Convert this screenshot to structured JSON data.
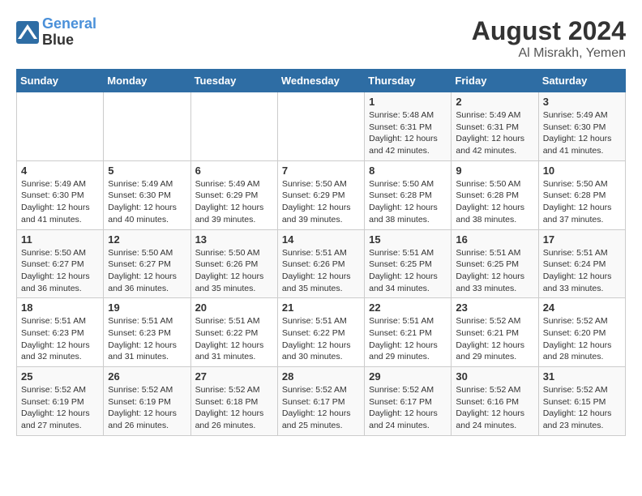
{
  "header": {
    "logo_line1": "General",
    "logo_line2": "Blue",
    "title": "August 2024",
    "subtitle": "Al Misrakh, Yemen"
  },
  "calendar": {
    "days_of_week": [
      "Sunday",
      "Monday",
      "Tuesday",
      "Wednesday",
      "Thursday",
      "Friday",
      "Saturday"
    ],
    "weeks": [
      [
        {
          "day": "",
          "info": ""
        },
        {
          "day": "",
          "info": ""
        },
        {
          "day": "",
          "info": ""
        },
        {
          "day": "",
          "info": ""
        },
        {
          "day": "1",
          "info": "Sunrise: 5:48 AM\nSunset: 6:31 PM\nDaylight: 12 hours\nand 42 minutes."
        },
        {
          "day": "2",
          "info": "Sunrise: 5:49 AM\nSunset: 6:31 PM\nDaylight: 12 hours\nand 42 minutes."
        },
        {
          "day": "3",
          "info": "Sunrise: 5:49 AM\nSunset: 6:30 PM\nDaylight: 12 hours\nand 41 minutes."
        }
      ],
      [
        {
          "day": "4",
          "info": "Sunrise: 5:49 AM\nSunset: 6:30 PM\nDaylight: 12 hours\nand 41 minutes."
        },
        {
          "day": "5",
          "info": "Sunrise: 5:49 AM\nSunset: 6:30 PM\nDaylight: 12 hours\nand 40 minutes."
        },
        {
          "day": "6",
          "info": "Sunrise: 5:49 AM\nSunset: 6:29 PM\nDaylight: 12 hours\nand 39 minutes."
        },
        {
          "day": "7",
          "info": "Sunrise: 5:50 AM\nSunset: 6:29 PM\nDaylight: 12 hours\nand 39 minutes."
        },
        {
          "day": "8",
          "info": "Sunrise: 5:50 AM\nSunset: 6:28 PM\nDaylight: 12 hours\nand 38 minutes."
        },
        {
          "day": "9",
          "info": "Sunrise: 5:50 AM\nSunset: 6:28 PM\nDaylight: 12 hours\nand 38 minutes."
        },
        {
          "day": "10",
          "info": "Sunrise: 5:50 AM\nSunset: 6:28 PM\nDaylight: 12 hours\nand 37 minutes."
        }
      ],
      [
        {
          "day": "11",
          "info": "Sunrise: 5:50 AM\nSunset: 6:27 PM\nDaylight: 12 hours\nand 36 minutes."
        },
        {
          "day": "12",
          "info": "Sunrise: 5:50 AM\nSunset: 6:27 PM\nDaylight: 12 hours\nand 36 minutes."
        },
        {
          "day": "13",
          "info": "Sunrise: 5:50 AM\nSunset: 6:26 PM\nDaylight: 12 hours\nand 35 minutes."
        },
        {
          "day": "14",
          "info": "Sunrise: 5:51 AM\nSunset: 6:26 PM\nDaylight: 12 hours\nand 35 minutes."
        },
        {
          "day": "15",
          "info": "Sunrise: 5:51 AM\nSunset: 6:25 PM\nDaylight: 12 hours\nand 34 minutes."
        },
        {
          "day": "16",
          "info": "Sunrise: 5:51 AM\nSunset: 6:25 PM\nDaylight: 12 hours\nand 33 minutes."
        },
        {
          "day": "17",
          "info": "Sunrise: 5:51 AM\nSunset: 6:24 PM\nDaylight: 12 hours\nand 33 minutes."
        }
      ],
      [
        {
          "day": "18",
          "info": "Sunrise: 5:51 AM\nSunset: 6:23 PM\nDaylight: 12 hours\nand 32 minutes."
        },
        {
          "day": "19",
          "info": "Sunrise: 5:51 AM\nSunset: 6:23 PM\nDaylight: 12 hours\nand 31 minutes."
        },
        {
          "day": "20",
          "info": "Sunrise: 5:51 AM\nSunset: 6:22 PM\nDaylight: 12 hours\nand 31 minutes."
        },
        {
          "day": "21",
          "info": "Sunrise: 5:51 AM\nSunset: 6:22 PM\nDaylight: 12 hours\nand 30 minutes."
        },
        {
          "day": "22",
          "info": "Sunrise: 5:51 AM\nSunset: 6:21 PM\nDaylight: 12 hours\nand 29 minutes."
        },
        {
          "day": "23",
          "info": "Sunrise: 5:52 AM\nSunset: 6:21 PM\nDaylight: 12 hours\nand 29 minutes."
        },
        {
          "day": "24",
          "info": "Sunrise: 5:52 AM\nSunset: 6:20 PM\nDaylight: 12 hours\nand 28 minutes."
        }
      ],
      [
        {
          "day": "25",
          "info": "Sunrise: 5:52 AM\nSunset: 6:19 PM\nDaylight: 12 hours\nand 27 minutes."
        },
        {
          "day": "26",
          "info": "Sunrise: 5:52 AM\nSunset: 6:19 PM\nDaylight: 12 hours\nand 26 minutes."
        },
        {
          "day": "27",
          "info": "Sunrise: 5:52 AM\nSunset: 6:18 PM\nDaylight: 12 hours\nand 26 minutes."
        },
        {
          "day": "28",
          "info": "Sunrise: 5:52 AM\nSunset: 6:17 PM\nDaylight: 12 hours\nand 25 minutes."
        },
        {
          "day": "29",
          "info": "Sunrise: 5:52 AM\nSunset: 6:17 PM\nDaylight: 12 hours\nand 24 minutes."
        },
        {
          "day": "30",
          "info": "Sunrise: 5:52 AM\nSunset: 6:16 PM\nDaylight: 12 hours\nand 24 minutes."
        },
        {
          "day": "31",
          "info": "Sunrise: 5:52 AM\nSunset: 6:15 PM\nDaylight: 12 hours\nand 23 minutes."
        }
      ]
    ]
  }
}
